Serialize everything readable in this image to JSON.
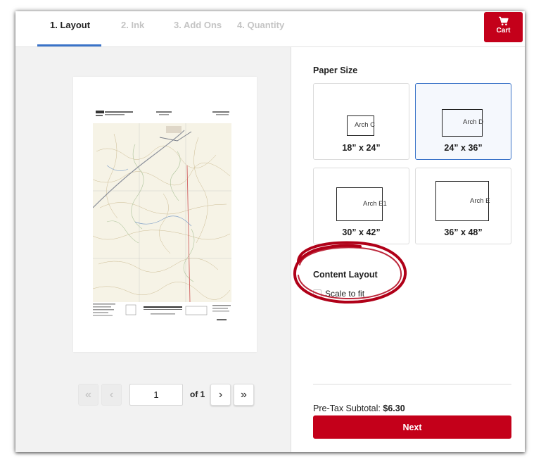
{
  "header": {
    "tabs": [
      {
        "label": "1. Layout",
        "active": true
      },
      {
        "label": "2. Ink",
        "active": false
      },
      {
        "label": "3. Add Ons",
        "active": false
      },
      {
        "label": "4. Quantity",
        "active": false
      }
    ],
    "cart": {
      "label": "Cart",
      "icon": "cart-icon"
    }
  },
  "preview": {
    "pager": {
      "first_label": "«",
      "prev_label": "‹",
      "page_value": "1",
      "of_label": "of 1",
      "next_label": "›",
      "last_label": "»"
    }
  },
  "options": {
    "paper_size_heading": "Paper Size",
    "sizes": [
      {
        "name": "Arch C",
        "dims": "18” x 24”",
        "selected": false
      },
      {
        "name": "Arch D",
        "dims": "24” x 36”",
        "selected": true
      },
      {
        "name": "Arch E1",
        "dims": "30” x 42”",
        "selected": false
      },
      {
        "name": "Arch E",
        "dims": "36” x 48”",
        "selected": false
      }
    ],
    "content_layout_heading": "Content Layout",
    "scale_to_fit_label": "Scale to fit",
    "subtotal_label": "Pre-Tax Subtotal:",
    "subtotal_value": "$6.30",
    "next_label": "Next"
  },
  "colors": {
    "accent_blue": "#3a73c8",
    "brand_red": "#c4001a",
    "annotation_red": "#b00018"
  }
}
